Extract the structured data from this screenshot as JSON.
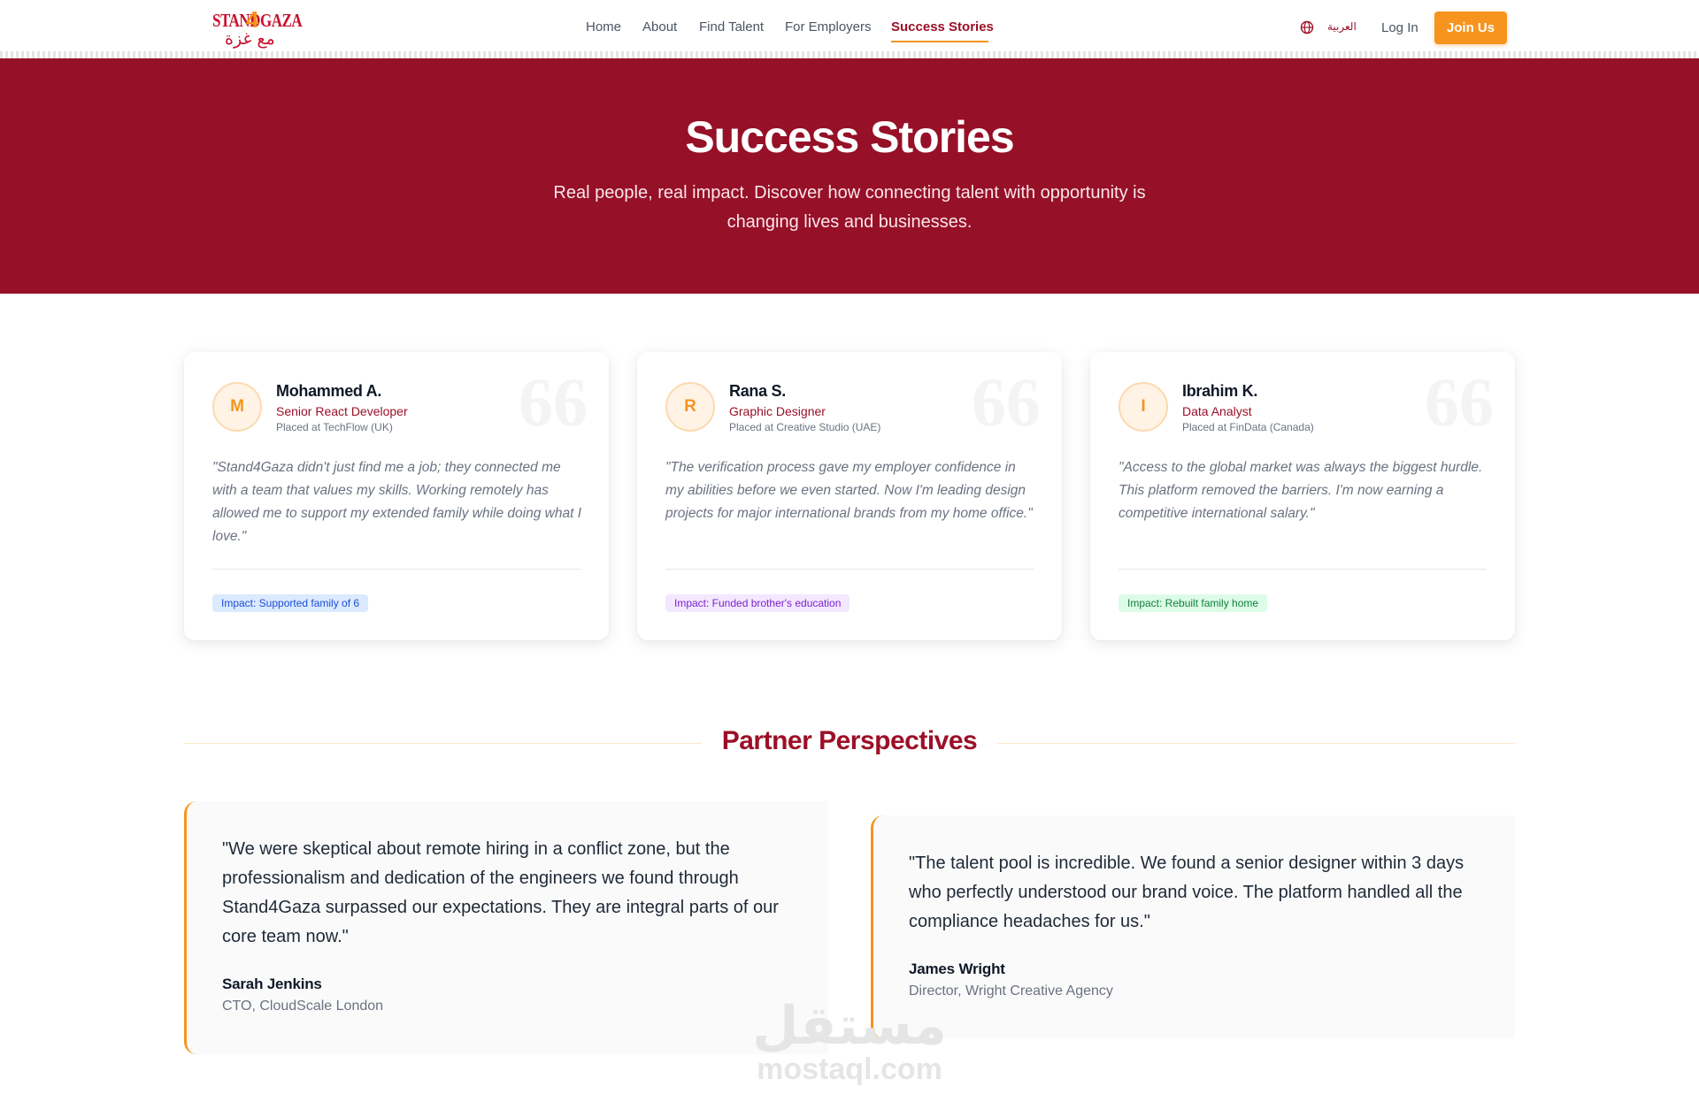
{
  "brand": {
    "logo_en_1": "STAND",
    "logo_4": "4",
    "logo_en_2": "GAZA",
    "logo_ar": "مع غزة",
    "accent": "#f7941d",
    "primary": "#961028"
  },
  "nav": {
    "items": [
      {
        "label": "Home"
      },
      {
        "label": "About"
      },
      {
        "label": "Find Talent"
      },
      {
        "label": "For Employers"
      },
      {
        "label": "Success Stories"
      }
    ],
    "language_icon": "globe-icon",
    "language_label": "العربية",
    "login_label": "Log In",
    "join_label": "Join Us"
  },
  "hero": {
    "title": "Success Stories",
    "subtitle": "Real people, real impact. Discover how connecting talent with opportunity is changing lives and businesses."
  },
  "stories": [
    {
      "initial": "M",
      "name": "Mohammed A.",
      "role": "Senior React Developer",
      "placed": "Placed at TechFlow (UK)",
      "quote": "\"Stand4Gaza didn't just find me a job; they connected me with a team that values my skills. Working remotely has allowed me to support my extended family while doing what I love.\"",
      "impact": "Impact: Supported family of 6"
    },
    {
      "initial": "R",
      "name": "Rana S.",
      "role": "Graphic Designer",
      "placed": "Placed at Creative Studio (UAE)",
      "quote": "\"The verification process gave my employer confidence in my abilities before we even started. Now I'm leading design projects for major international brands from my home office.\"",
      "impact": "Impact: Funded brother's education"
    },
    {
      "initial": "I",
      "name": "Ibrahim K.",
      "role": "Data Analyst",
      "placed": "Placed at FinData (Canada)",
      "quote": "\"Access to the global market was always the biggest hurdle. This platform removed the barriers. I'm now earning a competitive international salary.\"",
      "impact": "Impact: Rebuilt family home"
    }
  ],
  "quote_mark": "66",
  "partners": {
    "title": "Partner Perspectives",
    "items": [
      {
        "quote": "\"We were skeptical about remote hiring in a conflict zone, but the professionalism and dedication of the engineers we found through Stand4Gaza surpassed our expectations. They are integral parts of our core team now.\"",
        "name": "Sarah Jenkins",
        "title": "CTO, CloudScale London"
      },
      {
        "quote": "\"The talent pool is incredible. We found a senior designer within 3 days who perfectly understood our brand voice. The platform handled all the compliance headaches for us.\"",
        "name": "James Wright",
        "title": "Director, Wright Creative Agency"
      }
    ]
  },
  "watermark": {
    "ar": "مستقل",
    "en": "mostaql.com"
  }
}
